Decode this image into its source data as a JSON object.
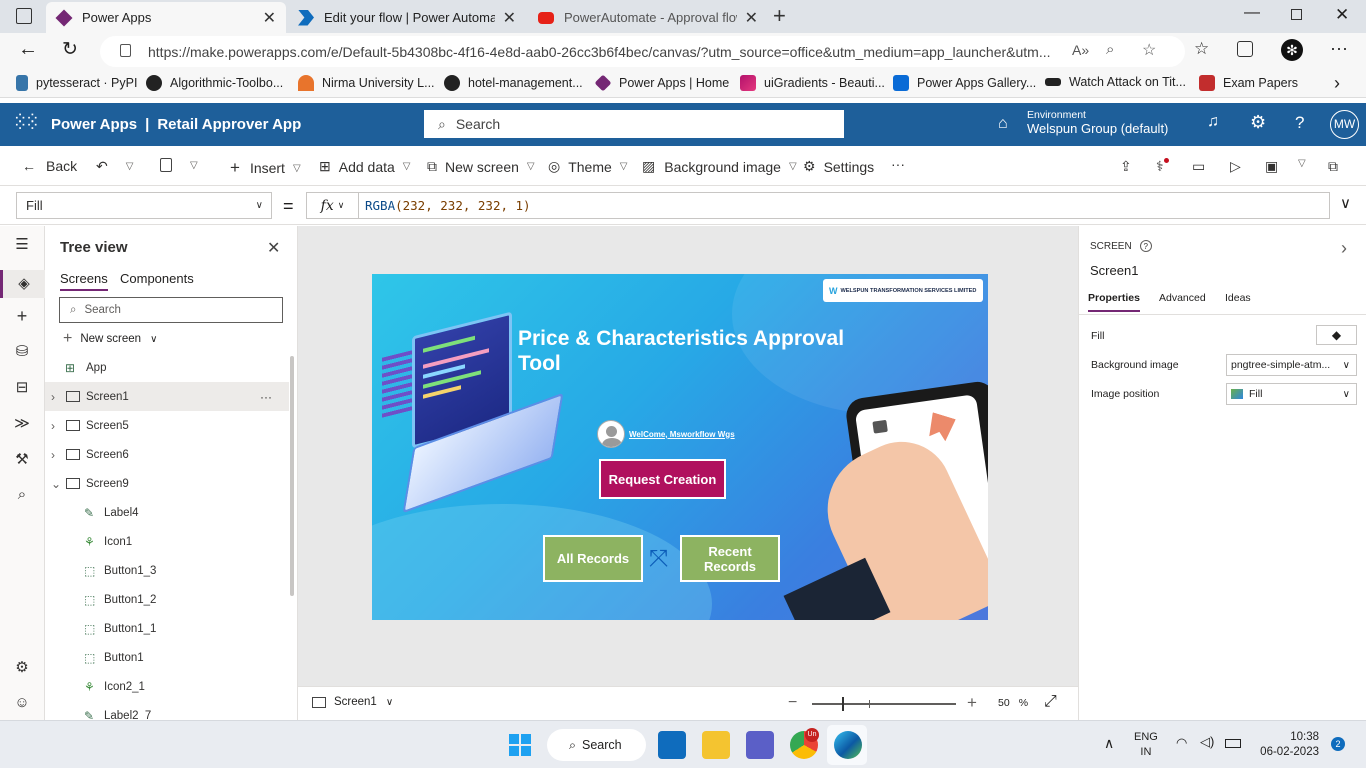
{
  "browser": {
    "tabs": [
      {
        "label": "Power Apps",
        "active": true
      },
      {
        "label": "Edit your flow | Power Automate",
        "active": false
      },
      {
        "label": "PowerAutomate - Approval flow",
        "active": false
      }
    ],
    "new_tab": "+",
    "url": "https://make.powerapps.com/e/Default-5b4308bc-4f16-4e8d-aab0-26cc3b6f4bec/canvas/?utm_source=office&utm_medium=app_launcher&utm...",
    "bookmarks": [
      "pytesseract · PyPI",
      "Algorithmic-Toolbo...",
      "Nirma University L...",
      "hotel-management...",
      "Power Apps | Home",
      "uiGradients - Beauti...",
      "Power Apps Gallery...",
      "Watch Attack on Tit...",
      "Exam Papers"
    ]
  },
  "header": {
    "app_title": "Power Apps",
    "separator": "|",
    "app_name": "Retail Approver App",
    "search_placeholder": "Search",
    "env_label": "Environment",
    "env_name": "Welspun Group (default)",
    "avatar": "MW",
    "help": "?"
  },
  "commands": {
    "back": "Back",
    "insert": "Insert",
    "add_data": "Add data",
    "new_screen": "New screen",
    "theme": "Theme",
    "background_image": "Background image",
    "settings": "Settings",
    "more": "···"
  },
  "formula": {
    "property": "Fill",
    "equals": "=",
    "fx": "fx",
    "func": "RGBA",
    "args": "(232, 232, 232, 1)"
  },
  "tree": {
    "title": "Tree view",
    "tabs": [
      "Screens",
      "Components"
    ],
    "search_placeholder": "Search",
    "new_screen": "New screen",
    "nodes": [
      {
        "label": "App",
        "level": 0,
        "kind": "app"
      },
      {
        "label": "Screen1",
        "level": 0,
        "kind": "screen",
        "selected": true,
        "expander": "›"
      },
      {
        "label": "Screen5",
        "level": 0,
        "kind": "screen",
        "expander": "›"
      },
      {
        "label": "Screen6",
        "level": 0,
        "kind": "screen",
        "expander": "›"
      },
      {
        "label": "Screen9",
        "level": 0,
        "kind": "screen",
        "expander": "⌄"
      },
      {
        "label": "Label4",
        "level": 1,
        "kind": "label"
      },
      {
        "label": "Icon1",
        "level": 1,
        "kind": "icon"
      },
      {
        "label": "Button1_3",
        "level": 1,
        "kind": "button"
      },
      {
        "label": "Button1_2",
        "level": 1,
        "kind": "button"
      },
      {
        "label": "Button1_1",
        "level": 1,
        "kind": "button"
      },
      {
        "label": "Button1",
        "level": 1,
        "kind": "button"
      },
      {
        "label": "Icon2_1",
        "level": 1,
        "kind": "icon"
      },
      {
        "label": "Label2_7",
        "level": 1,
        "kind": "label"
      }
    ]
  },
  "canvas": {
    "logo_text": "WELSPUN TRANSFORMATION SERVICES LIMITED",
    "title": "Price & Characteristics Approval Tool",
    "welcome": "WelCome, Msworkflow Wgs",
    "request_button": "Request Creation",
    "all_records_button": "All Records",
    "recent_records_button": "Recent Records",
    "colors": {
      "request": "#b0105e",
      "green": "#8db361"
    }
  },
  "bottom": {
    "screen": "Screen1",
    "zoom_minus": "−",
    "zoom_plus": "+",
    "zoom_level": 50,
    "zoom_value": "50",
    "zoom_unit": "%"
  },
  "properties": {
    "kind": "SCREEN",
    "name": "Screen1",
    "tabs": [
      "Properties",
      "Advanced",
      "Ideas"
    ],
    "fill_label": "Fill",
    "bg_label": "Background image",
    "bg_value": "pngtree-simple-atm...",
    "pos_label": "Image position",
    "pos_value": "Fill"
  },
  "taskbar": {
    "search": "Search",
    "lang1": "ENG",
    "lang2": "IN",
    "time": "10:38",
    "date": "06-02-2023",
    "notifications": "2",
    "chrome_badge": "Un"
  }
}
